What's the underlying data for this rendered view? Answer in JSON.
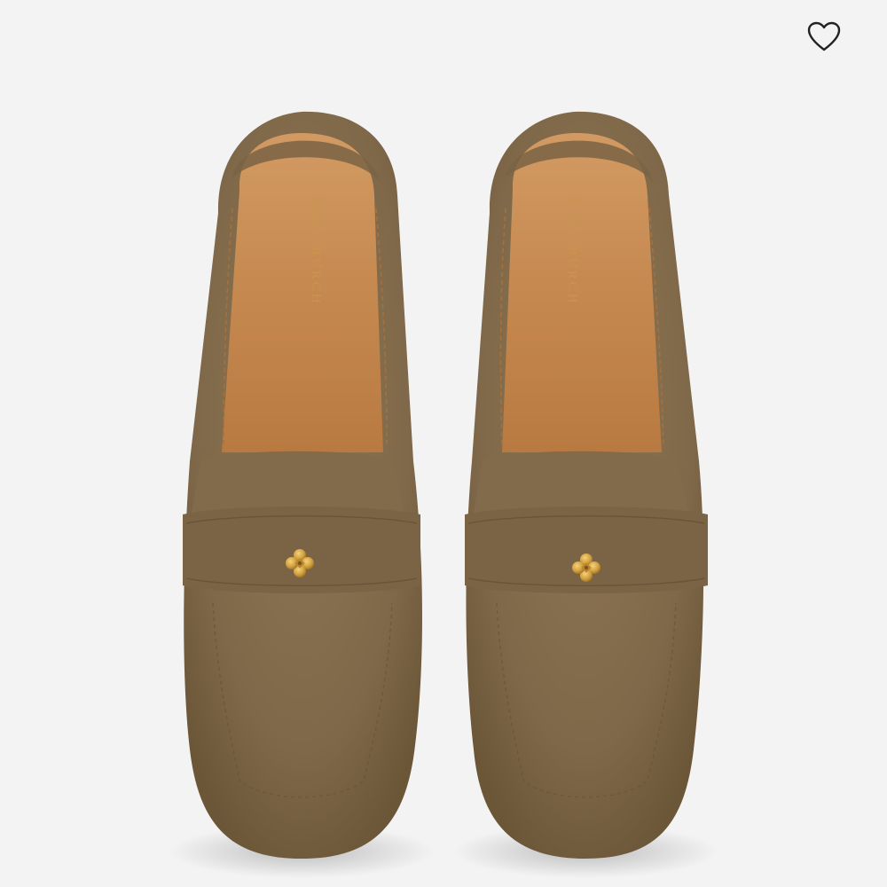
{
  "product": {
    "image_alt": "Tory Burch suede penny loafers, top view",
    "insole_brand": "TORY BURCH",
    "color": "#86704f"
  },
  "actions": {
    "favorite_icon": "heart-outline-icon"
  }
}
